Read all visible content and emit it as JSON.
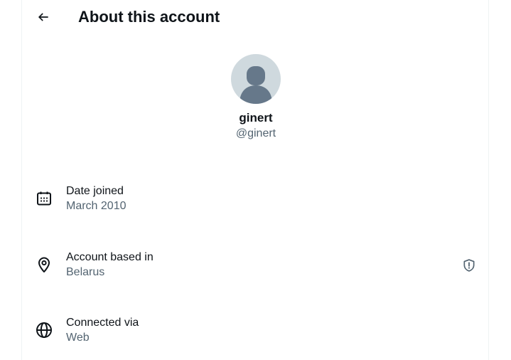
{
  "header": {
    "title": "About this account",
    "back_icon": "arrow-left-icon"
  },
  "profile": {
    "display_name": "ginert",
    "handle": "@ginert",
    "avatar_color": "#cfd9de"
  },
  "rows": [
    {
      "label": "Date joined",
      "value": "March 2010",
      "icon": "calendar-icon"
    },
    {
      "label": "Account based in",
      "value": "Belarus",
      "icon": "location-pin-icon",
      "badge_icon": "shield-alert-icon"
    },
    {
      "label": "Connected via",
      "value": "Web",
      "icon": "globe-icon"
    }
  ],
  "colors": {
    "text_primary": "#0f1419",
    "text_secondary": "#536471",
    "divider": "#eff3f4"
  }
}
